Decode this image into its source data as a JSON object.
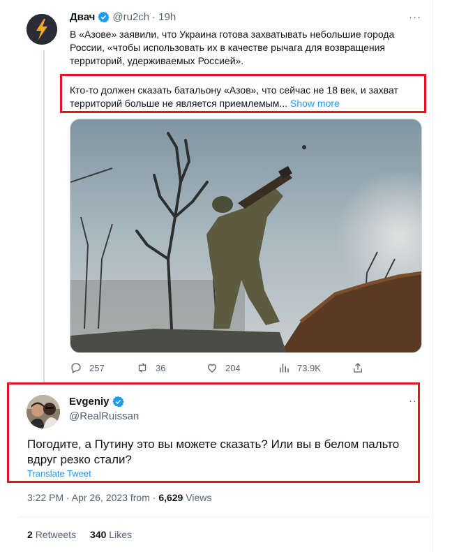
{
  "main_tweet": {
    "author_name": "Двач",
    "handle": "@ru2ch",
    "separator": "·",
    "time": "19h",
    "text": "В «Азове» заявили, что Украина готова захватывать небольшие города России, «чтобы использовать их в качестве рычага для возвращения территорий, удерживаемых Россией».",
    "quote_text": "Кто-то должен сказать батальону «Азов», что сейчас не 18 век, и захват территорий больше не является приемлемым...",
    "show_more_label": "Show more",
    "more_menu": "···",
    "actions": {
      "replies": "257",
      "retweets": "36",
      "likes": "204",
      "views": "73.9K"
    }
  },
  "reply_tweet": {
    "author_name": "Evgeniy",
    "handle": "@RealRuissan",
    "more_menu": "···",
    "text": "Погодите, а Путину это вы можете сказать? Или вы в белом пальто вдруг резко стали?",
    "translate_label": "Translate Tweet",
    "timestamp": "3:22 PM · Apr 26, 2023 from  · ",
    "views_count": "6,629",
    "views_label": "Views",
    "retweets_count": "2",
    "retweets_label": "Retweets",
    "likes_count": "340",
    "likes_label": "Likes"
  },
  "colors": {
    "accent": "#1d9bf0",
    "highlight_box": "#e3141f",
    "secondary_text": "#536471"
  }
}
